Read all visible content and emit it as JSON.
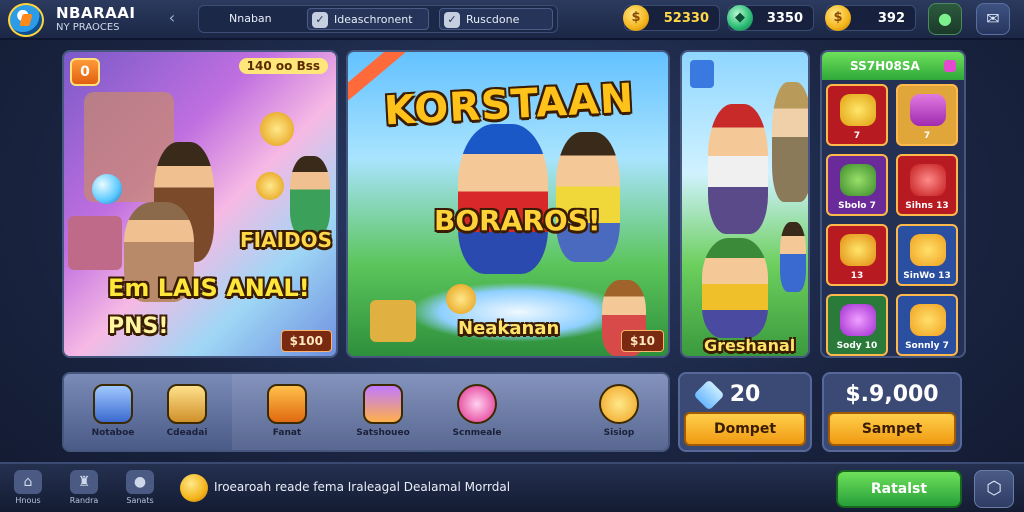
{
  "header": {
    "title": "NBARAAI",
    "subtitle": "NY PRAOCES",
    "tabs": [
      {
        "label": "Nnaban"
      },
      {
        "label": "Ideaschronent"
      },
      {
        "label": "Ruscdone"
      }
    ],
    "currencies": [
      {
        "icon": "gold-coin",
        "value": "52330"
      },
      {
        "icon": "gem",
        "value": "3350"
      },
      {
        "icon": "gold-coin",
        "value": "392"
      }
    ]
  },
  "banners": {
    "left": {
      "badge": "0",
      "promo": "140 oo Bss",
      "tag": "FIAIDOS",
      "headline": "Em LAIS ANAL!",
      "sub": "PNS!",
      "price": "$100"
    },
    "middle": {
      "title": "KORSTAAN",
      "sub": "BORAROS!",
      "name": "Neakanan",
      "price": "$10"
    },
    "right": {
      "name": "Greshanal"
    }
  },
  "shop": {
    "title": "SS7H08SA",
    "items": [
      {
        "label": "7"
      },
      {
        "label": "7"
      },
      {
        "label": "Sbolo 7"
      },
      {
        "label": "Sihns 13"
      },
      {
        "label": "13"
      },
      {
        "label": "SinWo 13"
      },
      {
        "label": "Sody 10"
      },
      {
        "label": "Sonnly 7"
      }
    ]
  },
  "inventory": {
    "slots": [
      {
        "label": "Notaboe"
      },
      {
        "label": "Cdeadai"
      },
      {
        "label": "Fanat"
      },
      {
        "label": "Satshoueo"
      },
      {
        "label": "Scnmeale"
      },
      {
        "label": "Sisiop"
      }
    ]
  },
  "deals": [
    {
      "value": "20",
      "button": "Dompet"
    },
    {
      "value": "$.9,000",
      "button": "Sampet"
    }
  ],
  "footer": {
    "nav": [
      {
        "label": "Hnous"
      },
      {
        "label": "Randra"
      },
      {
        "label": "Sanats"
      }
    ],
    "news": "Iroearoah reade fema Iraleagal Dealamal Morrdal",
    "primary_button": "Ratalst"
  }
}
